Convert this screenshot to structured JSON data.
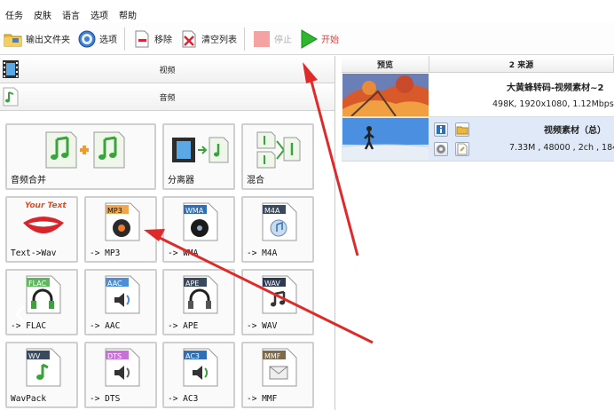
{
  "menu": [
    "任务",
    "皮肤",
    "语言",
    "选项",
    "帮助"
  ],
  "toolbar": {
    "output_folder": "输出文件夹",
    "options": "选项",
    "remove": "移除",
    "clear_list": "清空列表",
    "stop": "停止",
    "start": "开始"
  },
  "categories": {
    "video": "视频",
    "audio": "音频"
  },
  "tiles": [
    {
      "label": "音频合并",
      "badge": ""
    },
    {
      "label": "分离器",
      "badge": ""
    },
    {
      "label": "混合",
      "badge": ""
    },
    {
      "label": "Text->Wav",
      "badge": ""
    },
    {
      "label": "-> MP3",
      "badge": "MP3"
    },
    {
      "label": "-> WMA",
      "badge": "WMA"
    },
    {
      "label": "-> M4A",
      "badge": "M4A"
    },
    {
      "label": "-> FLAC",
      "badge": "FLAC"
    },
    {
      "label": "-> AAC",
      "badge": "AAC"
    },
    {
      "label": "-> APE",
      "badge": "APE"
    },
    {
      "label": "-> WAV",
      "badge": "WAV"
    },
    {
      "label": "WavPack",
      "badge": "WV"
    },
    {
      "label": "-> DTS",
      "badge": "DTS"
    },
    {
      "label": "-> AC3",
      "badge": "AC3"
    },
    {
      "label": "-> MMF",
      "badge": "MMF"
    }
  ],
  "text_wav_logo": "Your Text",
  "file_list": {
    "col_preview": "预览",
    "col_source": "2 来源",
    "rows": [
      {
        "name": "大黄蜂转码-视频素材~2",
        "info": "498K, 1920x1080, 1.12Mbps,"
      },
      {
        "name": "视频素材（总）",
        "info": "7.33M , 48000 , 2ch , 184"
      }
    ]
  }
}
